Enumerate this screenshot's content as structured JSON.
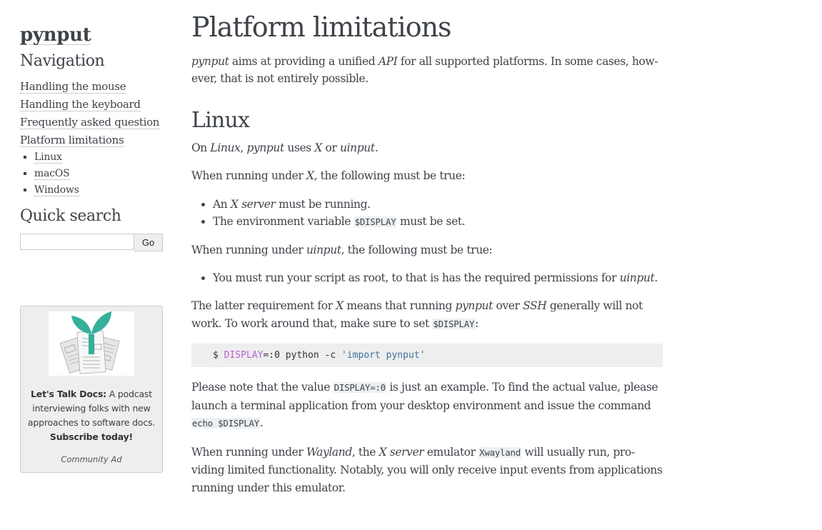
{
  "sidebar": {
    "logo": "pynput",
    "navigation_heading": "Navigation",
    "nav_items": [
      {
        "label": "Handling the mouse"
      },
      {
        "label": "Handling the keyboard"
      },
      {
        "label": "Frequently asked question"
      },
      {
        "label": "Platform limitations",
        "children": [
          {
            "label": "Linux"
          },
          {
            "label": "macOS"
          },
          {
            "label": "Windows"
          }
        ]
      }
    ],
    "search_heading": "Quick search",
    "search_value": "",
    "search_button": "Go"
  },
  "ad": {
    "image_icon": "plant-on-documents-icon",
    "title": "Let's Talk Docs:",
    "body": " A podcast interviewing folks with new approaches to software docs.",
    "cta": "Subscribe today!",
    "label": "Community Ad",
    "accent_color": "#35b09a"
  },
  "main": {
    "title": "Platform limitations",
    "intro": {
      "t1": "pynput",
      "t2": " aims at providing a unified ",
      "t3": "API",
      "t4": " for all supported platforms. In some cases, how­ever, that is not entirely possible."
    },
    "linux": {
      "heading": "Linux",
      "p1": {
        "a": "On ",
        "b": "Linux",
        "c": ", ",
        "d": "pynput",
        "e": " uses ",
        "f": "X",
        "g": " or ",
        "h": "uinput",
        "i": "."
      },
      "p2": {
        "a": "When running under ",
        "b": "X",
        "c": ", the following must be true:"
      },
      "x_list": [
        {
          "a": "An ",
          "b": "X server",
          "c": " must be running."
        },
        {
          "a": "The environment variable ",
          "code": "$DISPLAY",
          "c": " must be set."
        }
      ],
      "p3": {
        "a": "When running under ",
        "b": "uinput",
        "c": ", the following must be true:"
      },
      "uinput_list": [
        {
          "a": "You must run your script as root, to that is has the required permissions for ",
          "b": "uinput",
          "c": "."
        }
      ],
      "p4": {
        "a": "The latter requirement for ",
        "b": "X",
        "c": " means that running ",
        "d": "pynput",
        "e": " over ",
        "f": "SSH",
        "g": " generally will not work. To work around that, make sure to set ",
        "code": "$DISPLAY",
        "h": ":"
      },
      "codeblock": {
        "prompt": "$ ",
        "var": "DISPLAY",
        "rest": "=:0 python -c ",
        "str": "'import pynput'"
      },
      "p5": {
        "a": "Please note that the value ",
        "code": "DISPLAY=:0",
        "b": " is just an example. To find the actual value, please launch a terminal application from your desktop environment and issue the command ",
        "code2": "echo $DISPLAY",
        "c": "."
      },
      "p6": {
        "a": "When running under ",
        "b": "Wayland",
        "c": ", the ",
        "d": "X server",
        "e": " emulator ",
        "code": "Xwayland",
        "f": " will usually run, pro­viding limited functionality. Notably, you will only receive input events from applica­tions running under this emulator."
      }
    }
  }
}
